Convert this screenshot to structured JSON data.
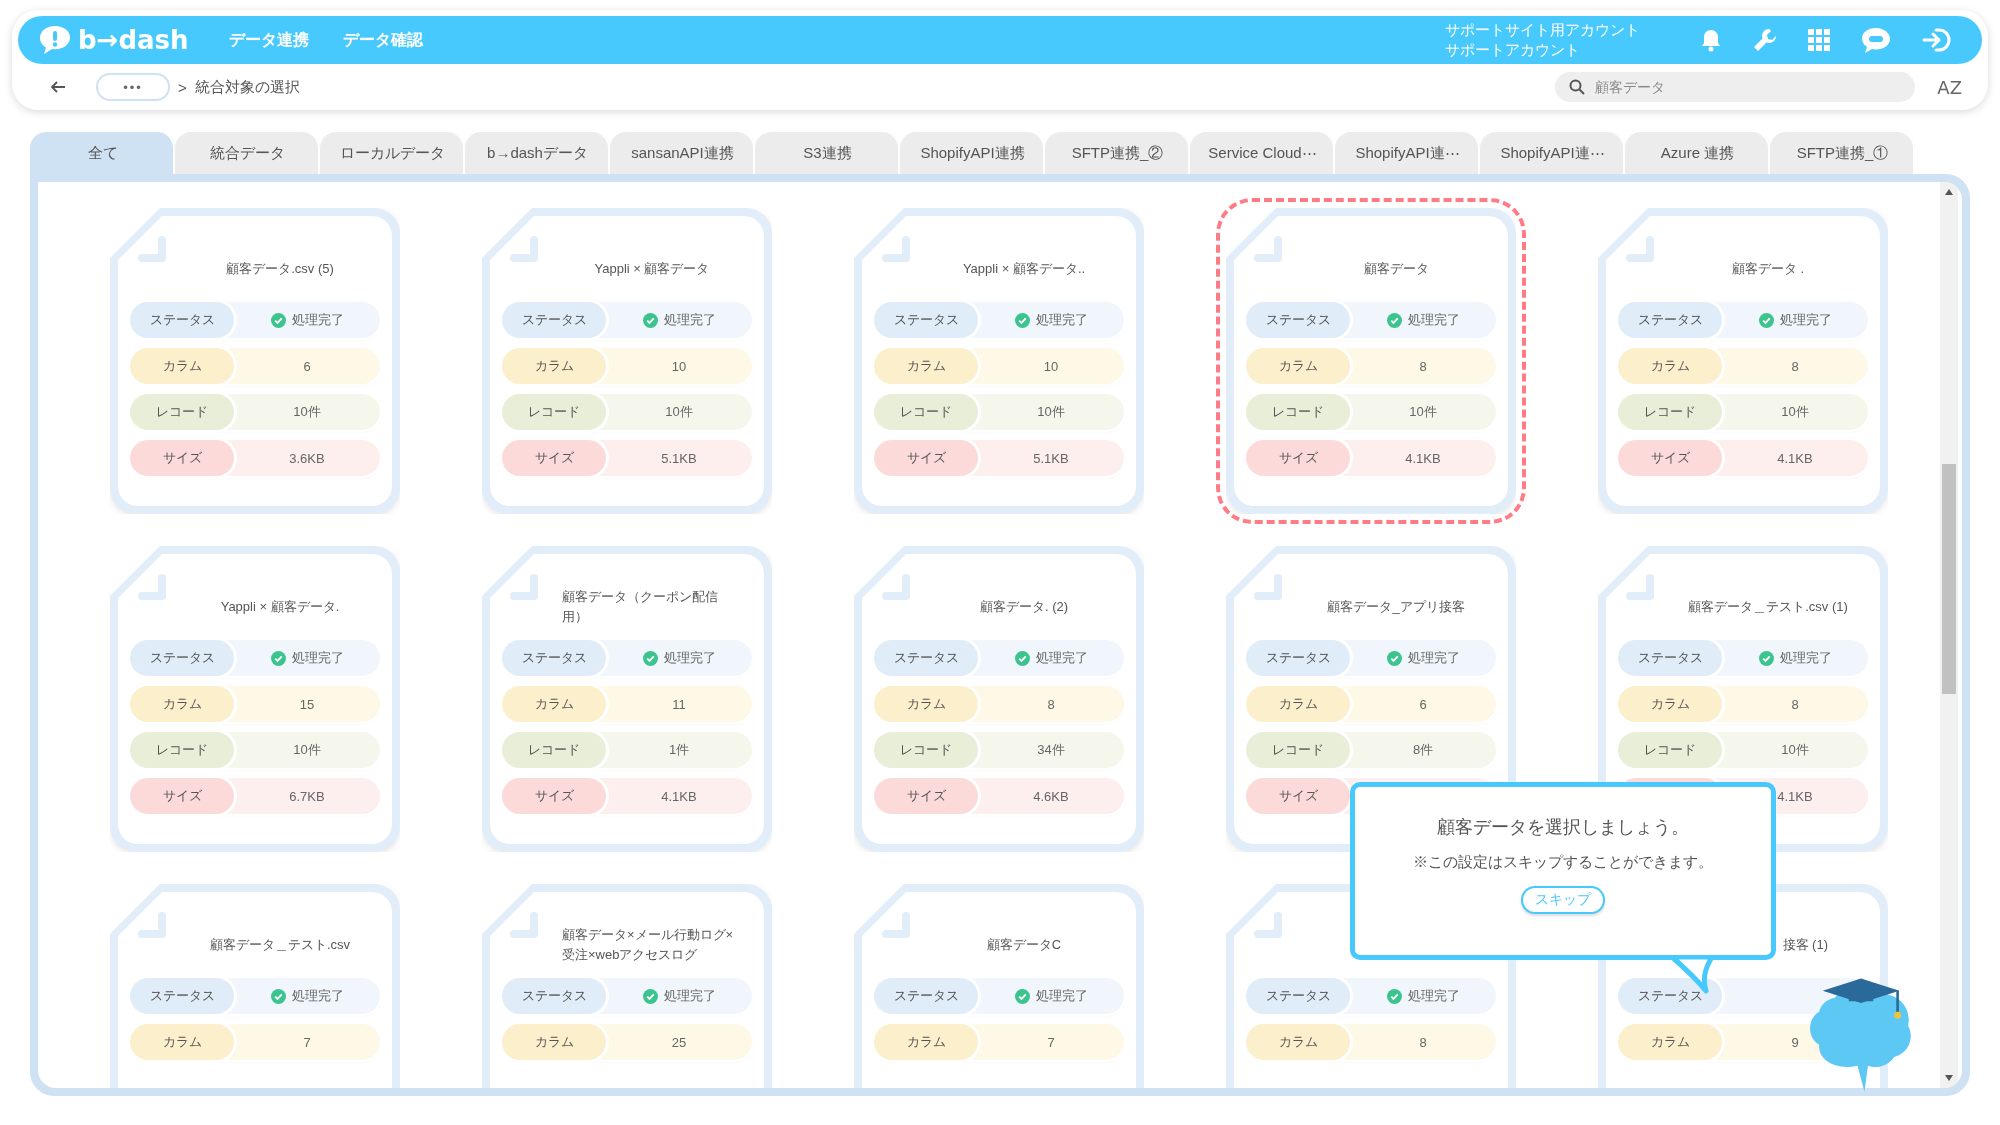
{
  "header": {
    "logo": "b→dash",
    "nav": [
      "データ連携",
      "データ確認"
    ],
    "account": [
      "サポートサイト用アカウント",
      "サポートアカウント"
    ]
  },
  "breadcrumb": {
    "more": "•••",
    "separator": ">",
    "current": "統合対象の選択"
  },
  "search": {
    "placeholder": "顧客データ"
  },
  "sort_button": "AZ",
  "tabs": [
    {
      "label": "全て",
      "selected": true
    },
    {
      "label": "統合データ",
      "selected": false
    },
    {
      "label": "ローカルデータ",
      "selected": false
    },
    {
      "label": "b→dashデータ",
      "selected": false
    },
    {
      "label": "sansanAPI連携",
      "selected": false
    },
    {
      "label": "S3連携",
      "selected": false
    },
    {
      "label": "ShopifyAPI連携",
      "selected": false
    },
    {
      "label": "SFTP連携_②",
      "selected": false
    },
    {
      "label": "Service Cloud⋯",
      "selected": false
    },
    {
      "label": "ShopifyAPI連⋯",
      "selected": false
    },
    {
      "label": "ShopifyAPI連⋯",
      "selected": false
    },
    {
      "label": "Azure 連携",
      "selected": false
    },
    {
      "label": "SFTP連携_①",
      "selected": false
    }
  ],
  "cards": [
    {
      "title": "顧客データ.csv (5)",
      "selected": false,
      "fields": [
        {
          "kind": "status",
          "label": "ステータス",
          "value": "処理完了"
        },
        {
          "kind": "column",
          "label": "カラム",
          "value": "6"
        },
        {
          "kind": "record",
          "label": "レコード",
          "value": "10件"
        },
        {
          "kind": "size",
          "label": "サイズ",
          "value": "3.6KB"
        }
      ]
    },
    {
      "title": "Yappli × 顧客データ",
      "selected": false,
      "fields": [
        {
          "kind": "status",
          "label": "ステータス",
          "value": "処理完了"
        },
        {
          "kind": "column",
          "label": "カラム",
          "value": "10"
        },
        {
          "kind": "record",
          "label": "レコード",
          "value": "10件"
        },
        {
          "kind": "size",
          "label": "サイズ",
          "value": "5.1KB"
        }
      ]
    },
    {
      "title": "Yappli × 顧客データ..",
      "selected": false,
      "fields": [
        {
          "kind": "status",
          "label": "ステータス",
          "value": "処理完了"
        },
        {
          "kind": "column",
          "label": "カラム",
          "value": "10"
        },
        {
          "kind": "record",
          "label": "レコード",
          "value": "10件"
        },
        {
          "kind": "size",
          "label": "サイズ",
          "value": "5.1KB"
        }
      ]
    },
    {
      "title": "顧客データ",
      "selected": true,
      "fields": [
        {
          "kind": "status",
          "label": "ステータス",
          "value": "処理完了"
        },
        {
          "kind": "column",
          "label": "カラム",
          "value": "8"
        },
        {
          "kind": "record",
          "label": "レコード",
          "value": "10件"
        },
        {
          "kind": "size",
          "label": "サイズ",
          "value": "4.1KB"
        }
      ]
    },
    {
      "title": "顧客データ .",
      "selected": false,
      "fields": [
        {
          "kind": "status",
          "label": "ステータス",
          "value": "処理完了"
        },
        {
          "kind": "column",
          "label": "カラム",
          "value": "8"
        },
        {
          "kind": "record",
          "label": "レコード",
          "value": "10件"
        },
        {
          "kind": "size",
          "label": "サイズ",
          "value": "4.1KB"
        }
      ]
    },
    {
      "title": "Yappli × 顧客データ.",
      "selected": false,
      "fields": [
        {
          "kind": "status",
          "label": "ステータス",
          "value": "処理完了"
        },
        {
          "kind": "column",
          "label": "カラム",
          "value": "15"
        },
        {
          "kind": "record",
          "label": "レコード",
          "value": "10件"
        },
        {
          "kind": "size",
          "label": "サイズ",
          "value": "6.7KB"
        }
      ]
    },
    {
      "title": "顧客データ（クーポン配信用）",
      "selected": false,
      "fields": [
        {
          "kind": "status",
          "label": "ステータス",
          "value": "処理完了"
        },
        {
          "kind": "column",
          "label": "カラム",
          "value": "11"
        },
        {
          "kind": "record",
          "label": "レコード",
          "value": "1件"
        },
        {
          "kind": "size",
          "label": "サイズ",
          "value": "4.1KB"
        }
      ]
    },
    {
      "title": "顧客データ. (2)",
      "selected": false,
      "fields": [
        {
          "kind": "status",
          "label": "ステータス",
          "value": "処理完了"
        },
        {
          "kind": "column",
          "label": "カラム",
          "value": "8"
        },
        {
          "kind": "record",
          "label": "レコード",
          "value": "34件"
        },
        {
          "kind": "size",
          "label": "サイズ",
          "value": "4.6KB"
        }
      ]
    },
    {
      "title": "顧客データ_アプリ接客",
      "selected": false,
      "fields": [
        {
          "kind": "status",
          "label": "ステータス",
          "value": "処理完了"
        },
        {
          "kind": "column",
          "label": "カラム",
          "value": "6"
        },
        {
          "kind": "record",
          "label": "レコード",
          "value": "8件"
        },
        {
          "kind": "size",
          "label": "サイズ"
        }
      ]
    },
    {
      "title": "顧客データ＿テスト.csv (1)",
      "selected": false,
      "fields": [
        {
          "kind": "status",
          "label": "ステータス",
          "value": "処理完了"
        },
        {
          "kind": "column",
          "label": "カラム",
          "value": "8"
        },
        {
          "kind": "record",
          "label": "レコード",
          "value": "10件"
        },
        {
          "kind": "size",
          "value": "4.1KB"
        }
      ]
    },
    {
      "title": "顧客データ＿テスト.csv",
      "selected": false,
      "fields": [
        {
          "kind": "status",
          "label": "ステータス",
          "value": "処理完了"
        },
        {
          "kind": "column",
          "label": "カラム",
          "value": "7"
        }
      ]
    },
    {
      "title": "顧客データ×メール行動ログ×受注×webアクセスログ",
      "selected": false,
      "fields": [
        {
          "kind": "status",
          "label": "ステータス",
          "value": "処理完了"
        },
        {
          "kind": "column",
          "label": "カラム",
          "value": "25"
        }
      ]
    },
    {
      "title": "顧客データC",
      "selected": false,
      "fields": [
        {
          "kind": "status",
          "label": "ステータス",
          "value": "処理完了"
        },
        {
          "kind": "column",
          "label": "カラム",
          "value": "7"
        }
      ]
    },
    {
      "selected": false,
      "fields": [
        {
          "kind": "status",
          "label": "ステータス",
          "value": "処理完了"
        },
        {
          "kind": "column",
          "label": "カラム",
          "value": "8"
        }
      ]
    },
    {
      "title": "接客 (1)",
      "covered": true,
      "selected": false,
      "fields": [
        {
          "kind": "status",
          "label": "ステータス"
        },
        {
          "kind": "column",
          "label": "カラム",
          "value": "9"
        }
      ]
    }
  ],
  "tooltip": {
    "heading": "顧客データを選択しましょう。",
    "note": "※この設定はスキップすることができます。",
    "button": "スキップ"
  }
}
